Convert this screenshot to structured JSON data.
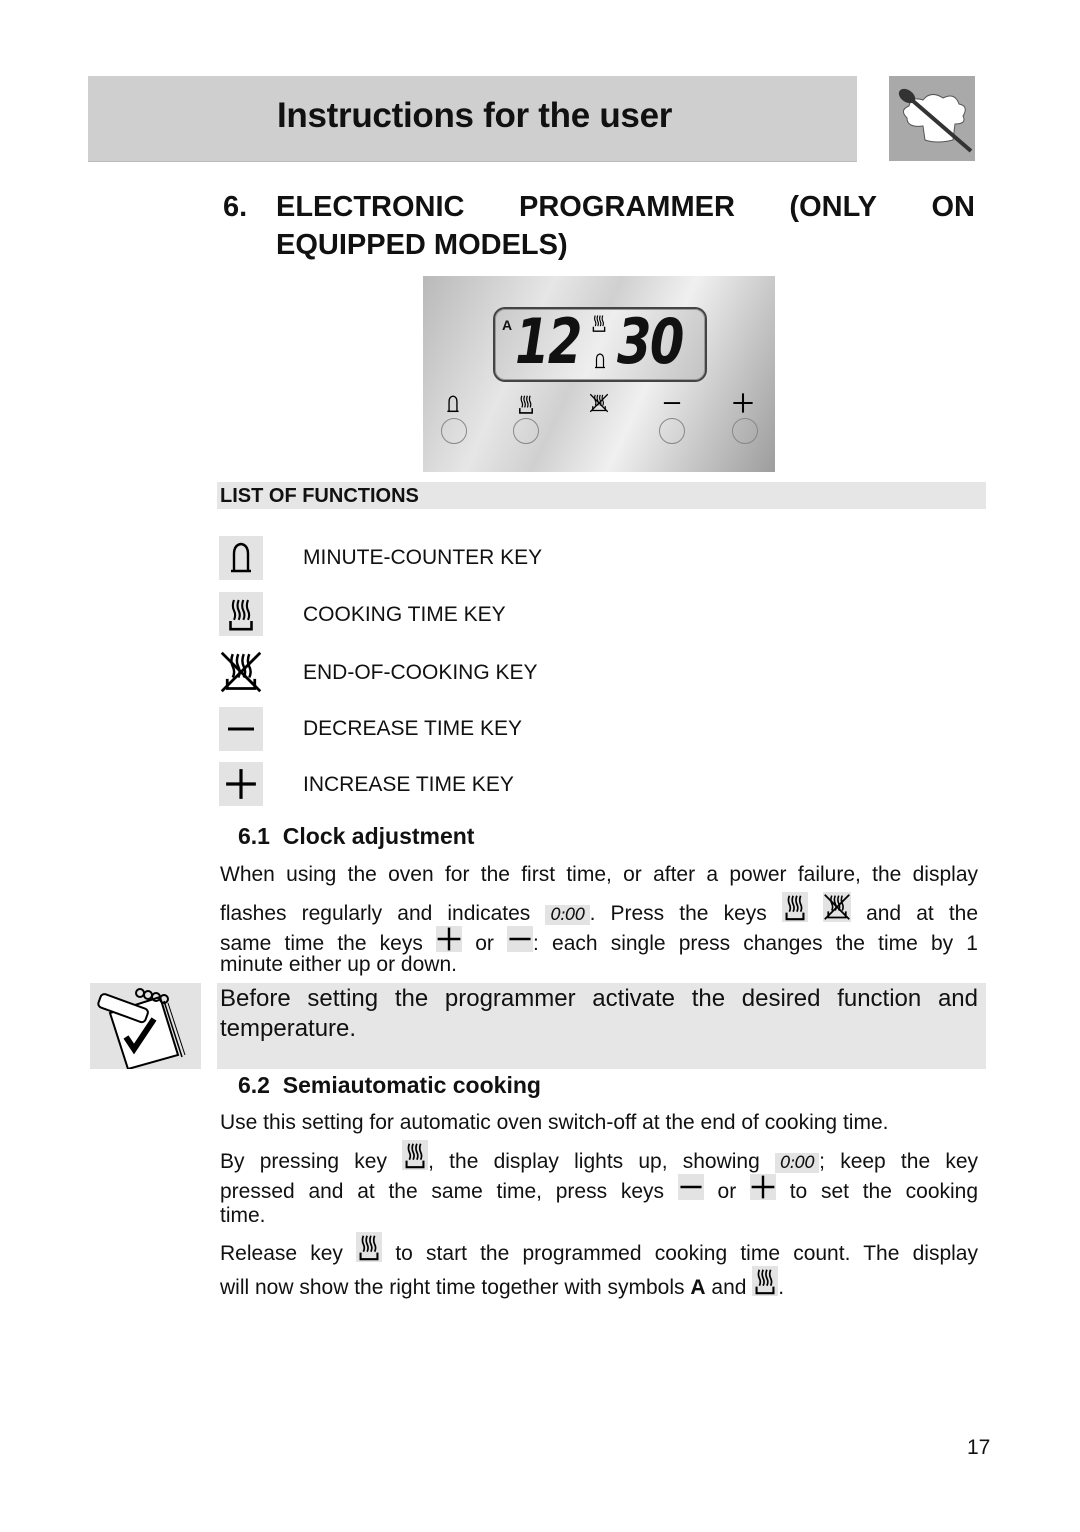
{
  "header": {
    "title": "Instructions for the user",
    "logo_icon": "chef-hat-spoon-icon"
  },
  "section": {
    "number": "6.",
    "title_line1_words": [
      "ELECTRONIC",
      "PROGRAMMER",
      "(ONLY",
      "ON"
    ],
    "title_line2": "EQUIPPED MODELS)"
  },
  "panel": {
    "display": {
      "auto_symbol": "A",
      "hours": "12",
      "minutes": "30",
      "indicator_icons": [
        "cooking-time-icon",
        "bell-icon"
      ]
    },
    "keys": [
      {
        "icon": "bell-icon",
        "has_button": true
      },
      {
        "icon": "cooking-time-icon",
        "has_button": true
      },
      {
        "icon": "end-of-cooking-icon",
        "has_button": false
      },
      {
        "icon": "minus-icon",
        "has_button": true
      },
      {
        "icon": "plus-icon",
        "has_button": true
      }
    ]
  },
  "functions": {
    "title": "LIST OF FUNCTIONS",
    "items": [
      {
        "icon": "bell-icon",
        "label": "MINUTE-COUNTER KEY"
      },
      {
        "icon": "cooking-time-icon",
        "label": "COOKING TIME KEY"
      },
      {
        "icon": "end-of-cooking-icon",
        "label": "END-OF-COOKING KEY"
      },
      {
        "icon": "minus-icon",
        "label": "DECREASE TIME KEY"
      },
      {
        "icon": "plus-icon",
        "label": "INCREASE TIME KEY"
      }
    ]
  },
  "clock": {
    "number": "6.1",
    "title": "Clock adjustment",
    "line1": "When using the oven for the first time, or after a power failure, the display",
    "line2_a": "flashes regularly and indicates",
    "line2_display": "0:00",
    "line2_b": ". Press the keys",
    "line2_c": "and at the",
    "line3_a": "same time the keys",
    "line3_b": "or",
    "line3_c": ": each single press changes the time by 1",
    "line4": "minute either up or down."
  },
  "note": {
    "icon": "notepad-checkmark-icon",
    "text": "Before setting the programmer activate the desired function and temperature."
  },
  "semiauto": {
    "number": "6.2",
    "title": "Semiautomatic cooking",
    "line1": "Use this setting for automatic oven switch-off at the end of cooking time.",
    "line2_a": "By pressing key",
    "line2_b": ", the display lights up, showing",
    "line2_display": "0:00",
    "line2_c": "; keep the key",
    "line3_a": "pressed and at the same time, press keys",
    "line3_b": "or",
    "line3_c": "to set the cooking",
    "line4": "time.",
    "line5_a": "Release key",
    "line5_b": "to start the programmed cooking time count. The display",
    "line6_a": "will now show the right time together with symbols",
    "line6_bold": "A",
    "line6_b": "and",
    "line6_end": "."
  },
  "footer": {
    "page_number": "17"
  }
}
